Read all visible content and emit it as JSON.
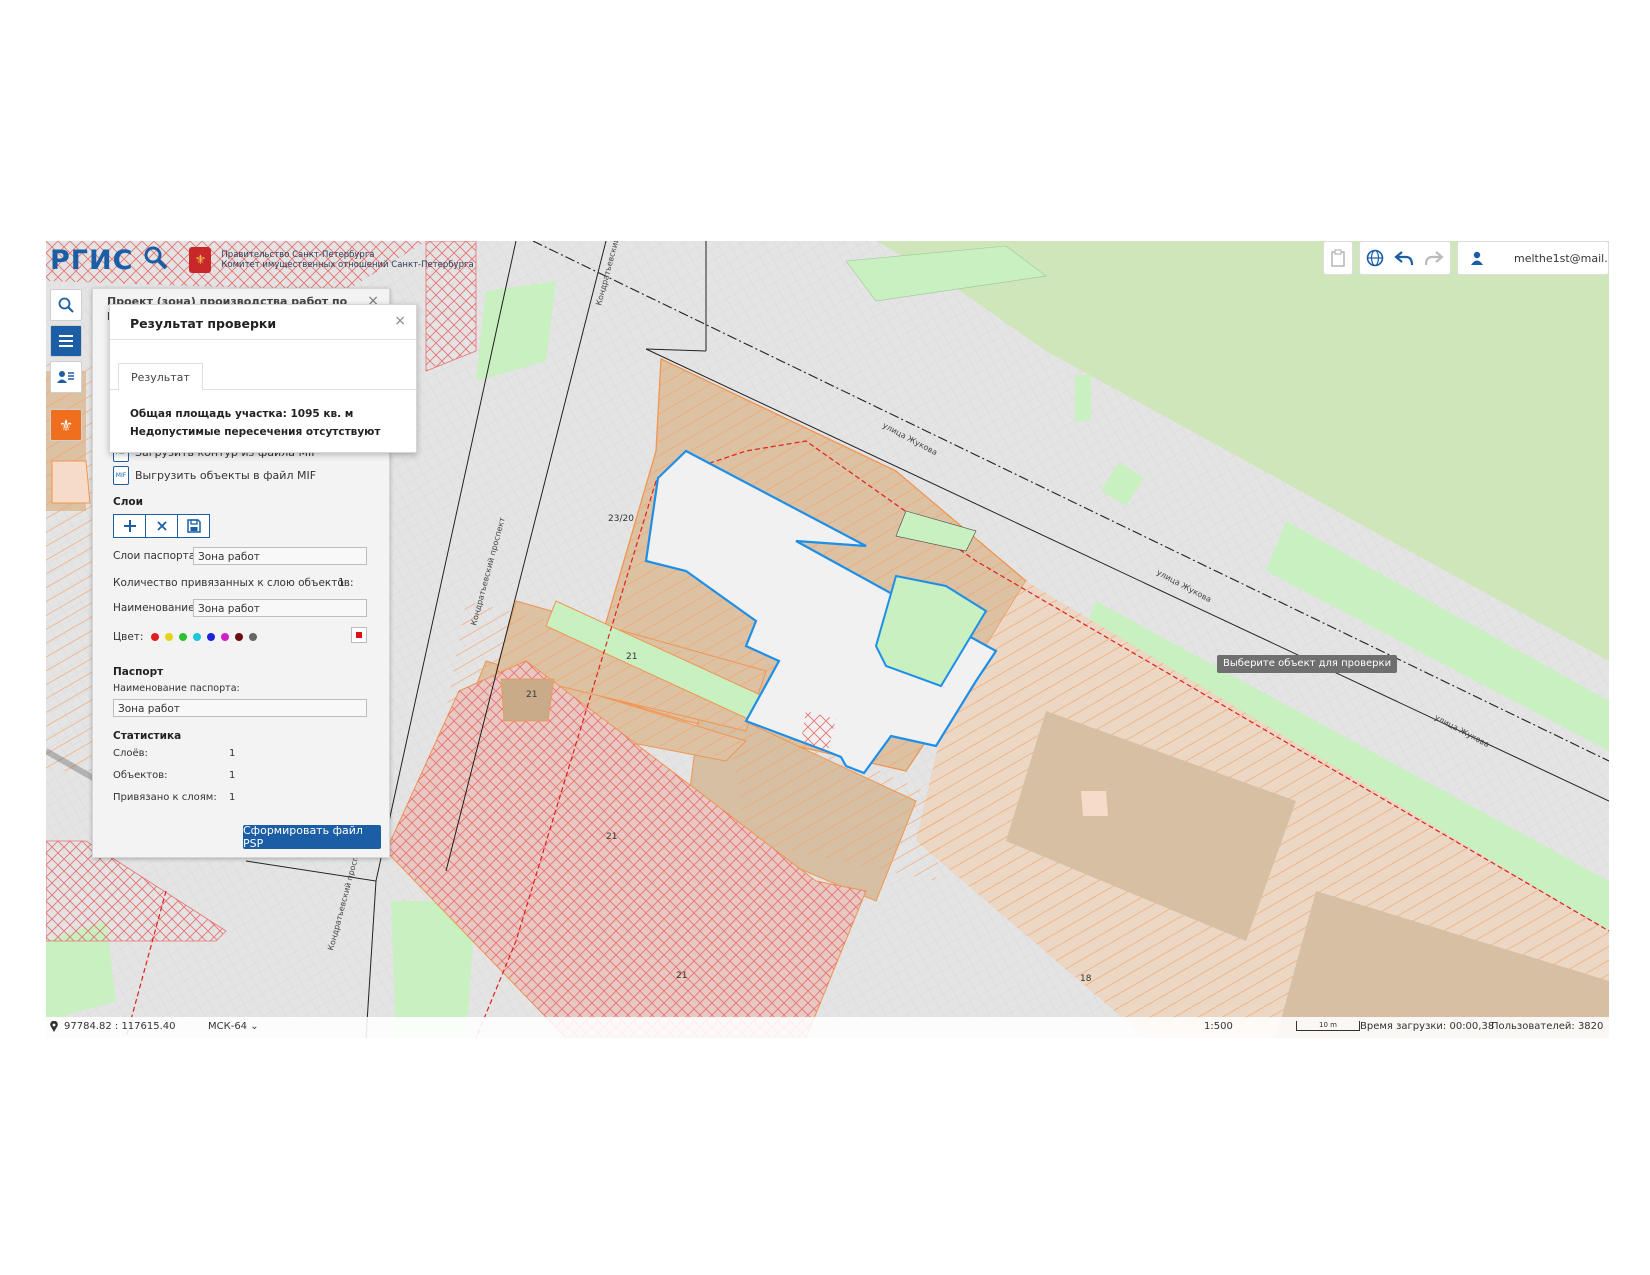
{
  "header": {
    "logo_text": "РГИС",
    "gov_line1": "Правительство Санкт-Петербурга",
    "gov_line2": "Комитет имущественных отношений Санкт-Петербурга",
    "user_email": "melthe1st@mail."
  },
  "icons": {
    "search": "search-icon",
    "menu": "menu-icon",
    "user_list": "user-list-icon",
    "coat_of_arms": "coat-of-arms-icon",
    "clipboard": "clipboard-icon",
    "globe": "globe-icon",
    "undo": "undo-icon",
    "redo": "redo-icon",
    "user": "user-icon",
    "location": "location-pin-icon"
  },
  "panel": {
    "title": "Проект (зона) производства работ по размещению",
    "mif_load": "Загрузить контур из файла MIF",
    "mif_export": "Выгрузить объекты в файл MIF",
    "layers_title": "Слои",
    "passport_layers_label": "Слои паспорта:",
    "passport_layers_value": "Зона работ",
    "linked_count_label": "Количество привязанных к слою объектов:",
    "linked_count_value": "1",
    "name_label": "Наименование:",
    "name_value": "Зона работ",
    "color_label": "Цвет:",
    "colors": [
      "#e02020",
      "#e6d21a",
      "#2fc02f",
      "#1fc7d8",
      "#2020d8",
      "#d020c8",
      "#6a1010",
      "#666666"
    ],
    "passport_title": "Паспорт",
    "passport_name_label": "Наименование паспорта:",
    "passport_name_value": "Зона работ",
    "stats_title": "Статистика",
    "stats": [
      {
        "label": "Слоёв:",
        "value": "1"
      },
      {
        "label": "Объектов:",
        "value": "1"
      },
      {
        "label": "Привязано к слоям:",
        "value": "1"
      }
    ],
    "psp_button": "Сформировать файл PSP"
  },
  "dialog": {
    "title": "Результат проверки",
    "tab": "Результат",
    "area_line": "Общая площадь участка: 1095 кв. м",
    "intersections_line": "Недопустимые пересечения отсутствуют"
  },
  "map": {
    "tooltip": "Выберите объект для проверки",
    "street_labels": [
      "улица Жукова",
      "улица Жукова",
      "улица Жукова",
      "Кондратьевский проспект",
      "Кондратьевский проспект",
      "Кондратьевский проспект"
    ],
    "parcel_labels": [
      "23/20",
      "21",
      "21",
      "21",
      "21",
      "18"
    ],
    "colors": {
      "road": "#e4e4e4",
      "park": "#cfe6bb",
      "green": "#c8f0c0",
      "parcel": "#dcc1a3",
      "parcel_light": "#f4dccb",
      "stripe": "#f2a56b",
      "redhatch": "#e87272",
      "selection": "#1e8fe8",
      "accent": "#1b5ea6"
    }
  },
  "status": {
    "coords": "97784.82 : 117615.40",
    "crs": "МСК-64",
    "scale": "1:500",
    "scalebar": "10 m",
    "load_time": "Время загрузки: 00:00,38",
    "users": "Пользователей: 3820"
  }
}
